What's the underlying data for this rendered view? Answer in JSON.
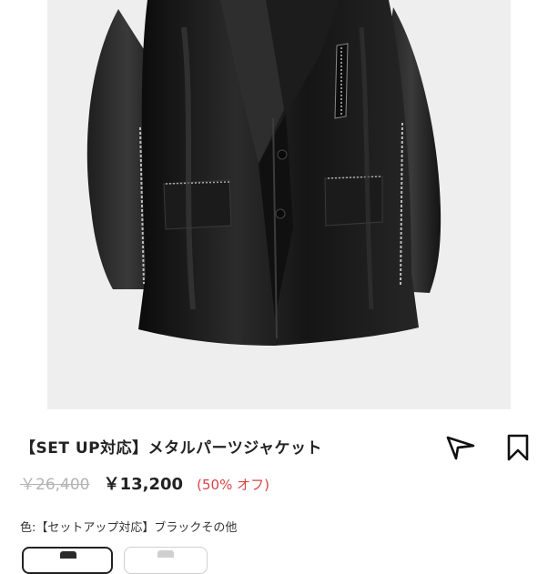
{
  "product": {
    "title": "【SET UP対応】メタルパーツジャケット",
    "original_price": "￥26,400",
    "sale_price": "￥13,200",
    "discount": "(50% オフ)"
  },
  "color": {
    "label": "色:【セットアップ対応】ブラックその他"
  },
  "icons": {
    "share": "send-icon",
    "bookmark": "bookmark-icon"
  },
  "colors": {
    "image_background": "#eeeeee",
    "discount_text": "#d64545",
    "jacket": "#141414"
  }
}
